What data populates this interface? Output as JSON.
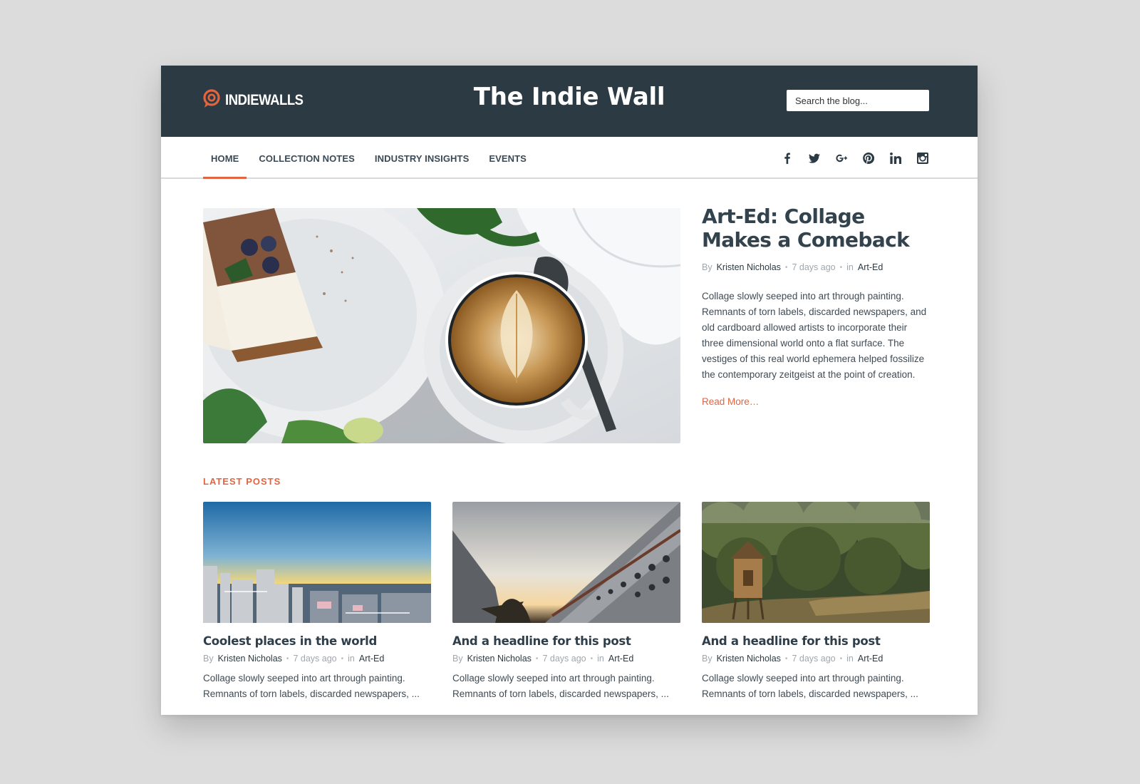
{
  "header": {
    "logo_text": "INDIEWALLS",
    "site_title": "The Indie Wall",
    "search_placeholder": "Search the blog..."
  },
  "nav": {
    "items": [
      {
        "label": "HOME",
        "active": true
      },
      {
        "label": "COLLECTION NOTES"
      },
      {
        "label": "INDUSTRY INSIGHTS"
      },
      {
        "label": "EVENTS"
      }
    ],
    "social": [
      "facebook-icon",
      "twitter-icon",
      "google-plus-icon",
      "pinterest-icon",
      "linkedin-icon",
      "instagram-icon"
    ]
  },
  "featured": {
    "title": "Art-Ed: Collage Makes a Comeback",
    "by": "By",
    "author": "Kristen Nicholas",
    "time": "7 days ago",
    "in": "in",
    "category": "Art-Ed",
    "excerpt": "Collage slowly seeped into art through painting. Remnants of torn labels, discarded newspapers, and old cardboard allowed artists to incorporate their three dimensional world onto a flat surface. The vestiges of this real world ephemera helped fossilize the contemporary zeitgeist at the point of creation.",
    "read_more": "Read More…",
    "image": "coffee-and-cake-photo"
  },
  "latest": {
    "label": "LATEST POSTS",
    "posts": [
      {
        "title": "Coolest places in the world",
        "by": "By",
        "author": "Kristen Nicholas",
        "time": "7 days ago",
        "in": "in",
        "category": "Art-Ed",
        "excerpt": "Collage slowly seeped into art through painting. Remnants of torn labels, discarded newspapers, ...",
        "image": "city-skyline-photo"
      },
      {
        "title": "And a headline for this post",
        "by": "By",
        "author": "Kristen Nicholas",
        "time": "7 days ago",
        "in": "in",
        "category": "Art-Ed",
        "excerpt": "Collage slowly seeped into art through painting. Remnants of torn labels, discarded newspapers, ...",
        "image": "cruise-ship-photo"
      },
      {
        "title": "And a headline for this post",
        "by": "By",
        "author": "Kristen Nicholas",
        "time": "7 days ago",
        "in": "in",
        "category": "Art-Ed",
        "excerpt": "Collage slowly seeped into art through painting. Remnants of torn labels, discarded newspapers, ...",
        "image": "forest-cabin-photo"
      }
    ]
  },
  "colors": {
    "header_bg": "#2c3a43",
    "accent": "#e4643f",
    "page_bg": "#dcdcdc"
  }
}
